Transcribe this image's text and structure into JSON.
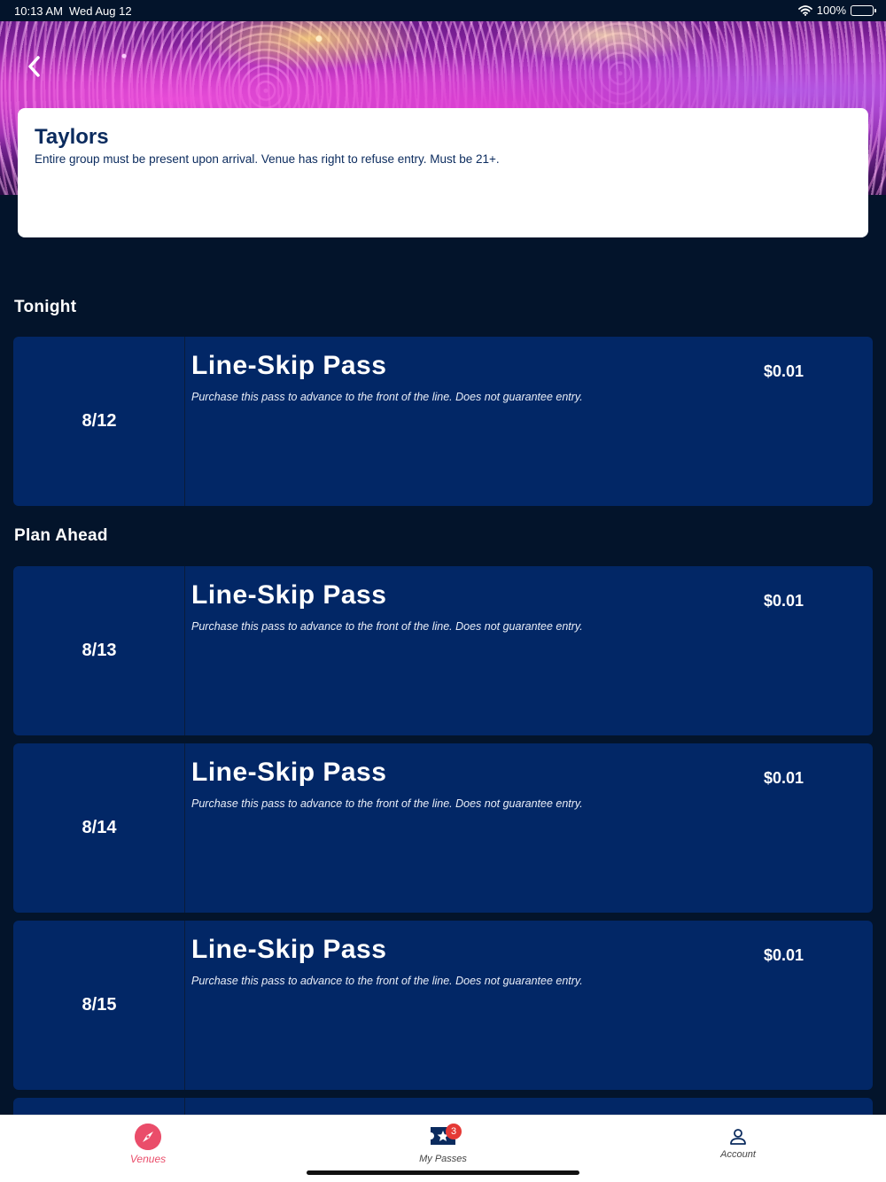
{
  "status_bar": {
    "time": "10:13 AM",
    "date": "Wed Aug 12",
    "battery": "100%"
  },
  "venue": {
    "name": "Taylors",
    "note": "Entire group must be present upon arrival. Venue has right to refuse entry. Must be 21+."
  },
  "sections": {
    "tonight": "Tonight",
    "plan_ahead": "Plan Ahead"
  },
  "passes": [
    {
      "date": "8/12",
      "name": "Line-Skip Pass",
      "description": "Purchase this pass to advance to the front of the line. Does not guarantee entry.",
      "price": "$0.01"
    },
    {
      "date": "8/13",
      "name": "Line-Skip Pass",
      "description": "Purchase this pass to advance to the front of the line. Does not guarantee entry.",
      "price": "$0.01"
    },
    {
      "date": "8/14",
      "name": "Line-Skip Pass",
      "description": "Purchase this pass to advance to the front of the line. Does not guarantee entry.",
      "price": "$0.01"
    },
    {
      "date": "8/15",
      "name": "Line-Skip Pass",
      "description": "Purchase this pass to advance to the front of the line. Does not guarantee entry.",
      "price": "$0.01"
    }
  ],
  "tabs": [
    {
      "label": "Venues",
      "icon": "compass-icon",
      "active": true
    },
    {
      "label": "My Passes",
      "icon": "ticket-star-icon",
      "badge": "3"
    },
    {
      "label": "Account",
      "icon": "person-icon"
    }
  ],
  "colors": {
    "card": "#022766",
    "background": "#03142b",
    "accent": "#ea4d6a",
    "badge": "#e53935"
  }
}
